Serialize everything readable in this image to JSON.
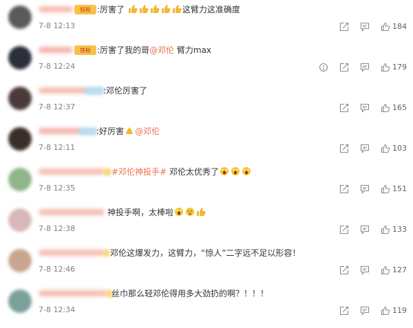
{
  "comments": [
    {
      "text": "厉害了👍👍👍👍👍这臂力这准确度",
      "text_parts": [
        "厉害了",
        "这臂力这准确度"
      ],
      "badge": "铁粉",
      "time": "7-8 12:13",
      "likes": "184",
      "has_report_icon": false,
      "avatar_color": "#5a5a5a",
      "nick_color": "#f3b2a4"
    },
    {
      "text": "厉害了我的哥@邓伦 臂力max",
      "text_parts": [
        "厉害了我的哥",
        "@邓伦",
        " 臂力max"
      ],
      "badge": "铁粉",
      "time": "7-8 12:24",
      "likes": "179",
      "has_report_icon": true,
      "avatar_color": "#2a2f3a",
      "nick_color": "#f1a99c"
    },
    {
      "text": "邓伦厉害了",
      "text_parts": [
        "邓伦厉害了"
      ],
      "badge": "",
      "time": "7-8 12:37",
      "likes": "165",
      "has_report_icon": false,
      "avatar_color": "#4a3a3a",
      "nick_color": "#f3b2a4"
    },
    {
      "text": "好厉害🙏@邓伦",
      "text_parts": [
        "好厉害",
        "@邓伦"
      ],
      "badge": "",
      "time": "7-8 12:11",
      "likes": "103",
      "has_report_icon": false,
      "avatar_color": "#3a2e2a",
      "nick_color": "#f1a99c"
    },
    {
      "text": "#邓伦神投手# 邓伦太优秀了😱😱😱",
      "text_parts": [
        "#邓伦神投手#",
        " 邓伦太优秀了"
      ],
      "badge": "",
      "time": "7-8 12:35",
      "likes": "151",
      "has_report_icon": false,
      "avatar_color": "#8fb58a",
      "nick_color": "#f3b2a4"
    },
    {
      "text": "神投手啊，太棒啦😱😨👍",
      "text_parts": [
        "神投手啊，太棒啦"
      ],
      "badge": "",
      "time": "7-8 12:38",
      "likes": "133",
      "has_report_icon": false,
      "avatar_color": "#d8b8b8",
      "nick_color": "#f3b2a4"
    },
    {
      "text": "邓伦这爆发力，这臂力，“惊人”二字远不足以形容！",
      "text_parts": [
        "邓伦这爆发力，这臂力，“惊人”二字远不足以形容！"
      ],
      "badge": "",
      "time": "7-8 12:46",
      "likes": "127",
      "has_report_icon": false,
      "avatar_color": "#c9a58f",
      "nick_color": "#f3b2a4"
    },
    {
      "text": "丝巾那么轻邓伦得用多大劲扔的啊？！！！",
      "text_parts": [
        "丝巾那么轻邓伦得用多大劲扔的啊？！！！"
      ],
      "badge": "",
      "time": "7-8 12:34",
      "likes": "119",
      "has_report_icon": false,
      "avatar_color": "#7aa09a",
      "nick_color": "#f3b2a4"
    }
  ],
  "icons": {
    "report": "report-icon",
    "share": "share-icon",
    "comment": "comment-icon",
    "like": "thumbs-up-icon"
  },
  "colors": {
    "text": "#333333",
    "mention": "#eb7350",
    "time": "#808080",
    "icon": "#8a8a8a"
  }
}
